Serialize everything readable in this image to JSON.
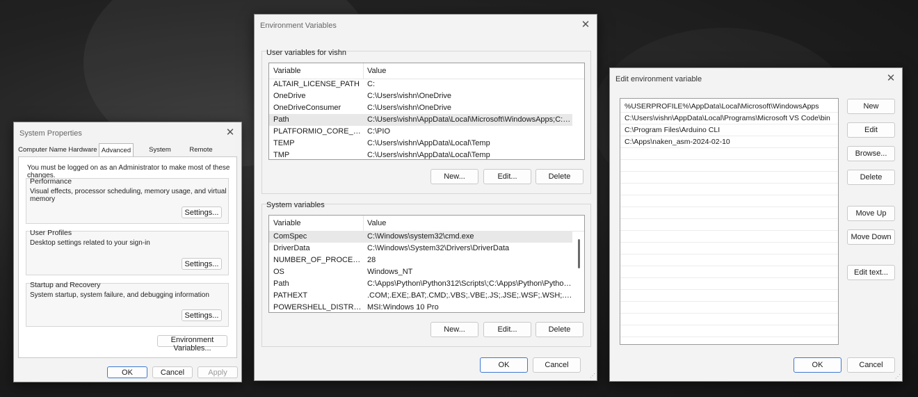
{
  "system_properties": {
    "title": "System Properties",
    "tabs": [
      "Computer Name",
      "Hardware",
      "Advanced",
      "System Protection",
      "Remote"
    ],
    "admin_note": "You must be logged on as an Administrator to make most of these changes.",
    "performance": {
      "label": "Performance",
      "desc": "Visual effects, processor scheduling, memory usage, and virtual memory",
      "button": "Settings..."
    },
    "user_profiles": {
      "label": "User Profiles",
      "desc": "Desktop settings related to your sign-in",
      "button": "Settings..."
    },
    "startup": {
      "label": "Startup and Recovery",
      "desc": "System startup, system failure, and debugging information",
      "button": "Settings..."
    },
    "env_button": "Environment Variables...",
    "ok": "OK",
    "cancel": "Cancel",
    "apply": "Apply"
  },
  "env_vars": {
    "title": "Environment Variables",
    "user_section": "User variables for vishn",
    "col_variable": "Variable",
    "col_value": "Value",
    "user_rows": [
      {
        "variable": "ALTAIR_LICENSE_PATH",
        "value": "C:"
      },
      {
        "variable": "OneDrive",
        "value": "C:\\Users\\vishn\\OneDrive"
      },
      {
        "variable": "OneDriveConsumer",
        "value": "C:\\Users\\vishn\\OneDrive"
      },
      {
        "variable": "Path",
        "value": "C:\\Users\\vishn\\AppData\\Local\\Microsoft\\WindowsApps;C:\\U..."
      },
      {
        "variable": "PLATFORMIO_CORE_DIR",
        "value": "C:\\PIO"
      },
      {
        "variable": "TEMP",
        "value": "C:\\Users\\vishn\\AppData\\Local\\Temp"
      },
      {
        "variable": "TMP",
        "value": "C:\\Users\\vishn\\AppData\\Local\\Temp"
      }
    ],
    "system_section": "System variables",
    "system_rows": [
      {
        "variable": "ComSpec",
        "value": "C:\\Windows\\system32\\cmd.exe"
      },
      {
        "variable": "DriverData",
        "value": "C:\\Windows\\System32\\Drivers\\DriverData"
      },
      {
        "variable": "NUMBER_OF_PROCESSORS",
        "value": "28"
      },
      {
        "variable": "OS",
        "value": "Windows_NT"
      },
      {
        "variable": "Path",
        "value": "C:\\Apps\\Python\\Python312\\Scripts\\;C:\\Apps\\Python\\Python31..."
      },
      {
        "variable": "PATHEXT",
        "value": ".COM;.EXE;.BAT;.CMD;.VBS;.VBE;.JS;.JSE;.WSF;.WSH;.MSC;.PY;.P..."
      },
      {
        "variable": "POWERSHELL_DISTRIBUTI...",
        "value": "MSI:Windows 10 Pro"
      }
    ],
    "new": "New...",
    "edit": "Edit...",
    "delete": "Delete",
    "ok": "OK",
    "cancel": "Cancel"
  },
  "edit_env": {
    "title": "Edit environment variable",
    "entries": [
      "%USERPROFILE%\\AppData\\Local\\Microsoft\\WindowsApps",
      "C:\\Users\\vishn\\AppData\\Local\\Programs\\Microsoft VS Code\\bin",
      "C:\\Program Files\\Arduino CLI",
      "C:\\Apps\\naken_asm-2024-02-10"
    ],
    "new": "New",
    "edit": "Edit",
    "browse": "Browse...",
    "delete": "Delete",
    "move_up": "Move Up",
    "move_down": "Move Down",
    "edit_text": "Edit text...",
    "ok": "OK",
    "cancel": "Cancel"
  }
}
